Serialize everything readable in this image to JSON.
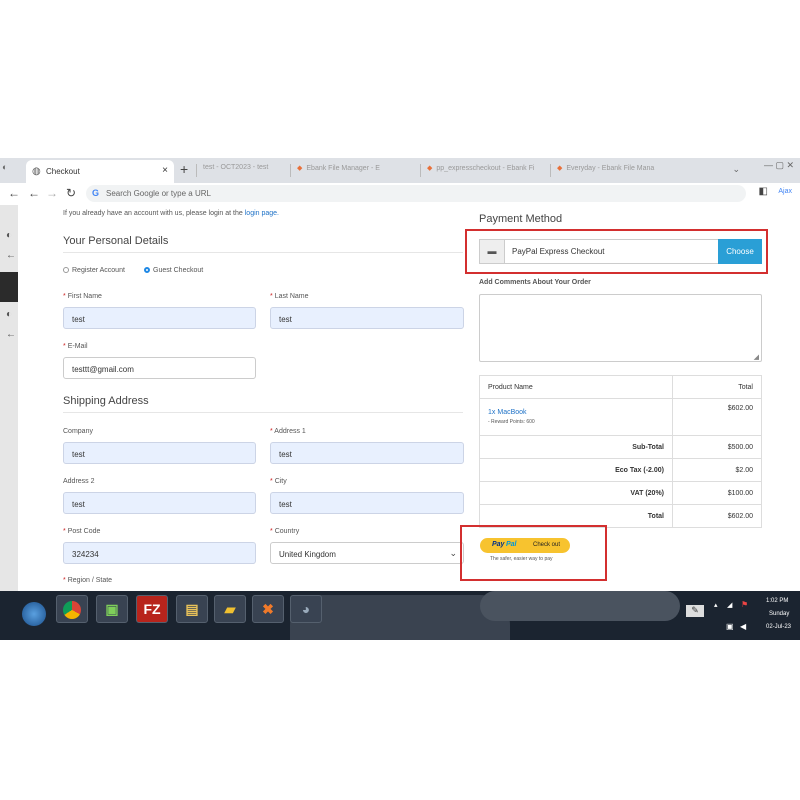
{
  "browser": {
    "tab_title": "Checkout",
    "tab_close": "×",
    "new_tab": "+",
    "bg_tabs": [
      "test - OCT2023 - test",
      "Ebank File Manager - E",
      "pp_expresscheckout - Ebank Fi",
      "Everyday - Ebank File Mana"
    ],
    "omnibox_placeholder": "Search Google or type a URL",
    "profile_label": "Ajax",
    "win_controls": "— ▢ ✕"
  },
  "page": {
    "login_prompt": "If you already have an account with us, please login at the",
    "login_link": "login page.",
    "personal_heading": "Your Personal Details",
    "radio_register": "Register Account",
    "radio_guest": "Guest Checkout",
    "first_name_label": "First Name",
    "first_name_value": "test",
    "last_name_label": "Last Name",
    "last_name_value": "test",
    "email_label": "E-Mail",
    "email_value": "testtt@gmail.com",
    "shipping_heading": "Shipping Address",
    "company_label": "Company",
    "company_value": "test",
    "address1_label": "Address 1",
    "address1_value": "test",
    "address2_label": "Address 2",
    "address2_value": "test",
    "city_label": "City",
    "city_value": "test",
    "postcode_label": "Post Code",
    "postcode_value": "324234",
    "country_label": "Country",
    "country_value": "United Kingdom",
    "region_label": "Region / State",
    "required_mark": "*"
  },
  "payment": {
    "heading": "Payment Method",
    "method": "PayPal Express Checkout",
    "choose_button": "Choose",
    "comments_label": "Add Comments About Your Order",
    "table_head_product": "Product Name",
    "table_head_total": "Total",
    "item_qty": "1x",
    "item_name": "MacBook",
    "item_reward": "- Reward Points: 600",
    "item_total": "$602.00",
    "totals": [
      {
        "label": "Sub-Total",
        "value": "$500.00"
      },
      {
        "label": "Eco Tax (-2.00)",
        "value": "$2.00"
      },
      {
        "label": "VAT (20%)",
        "value": "$100.00"
      },
      {
        "label": "Total",
        "value": "$602.00"
      }
    ],
    "paypal_brand_1": "Pay",
    "paypal_brand_2": "Pal",
    "paypal_checkout": "Check out",
    "paypal_tagline": "The safer, easier way to pay"
  },
  "taskbar": {
    "time": "1:02 PM",
    "day": "Sunday",
    "date": "02-Jul-23",
    "filezilla_label": "FZ"
  },
  "colors": {
    "accent": "#2a9fd6",
    "highlight_box": "#d32f2f",
    "paypal_yellow": "#f7c32f",
    "autofill_bg": "#e8f0fe"
  }
}
